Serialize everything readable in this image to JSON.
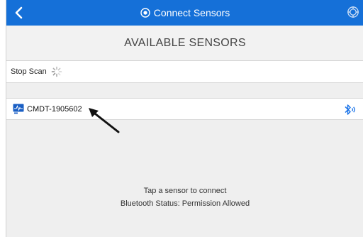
{
  "nav": {
    "title": "Connect Sensors",
    "back_icon": "chevron-left-icon",
    "settings_icon": "gear-icon",
    "bar_color": "#1570d8"
  },
  "header": {
    "title": "AVAILABLE SENSORS"
  },
  "scan": {
    "label": "Stop Scan",
    "spinner_icon": "loading-spinner-icon"
  },
  "sensors": [
    {
      "name": "CMDT-1905602",
      "icon": "sensor-device-icon",
      "status_icon": "bluetooth-icon"
    }
  ],
  "footer": {
    "hint": "Tap a sensor to connect",
    "bt_status": "Bluetooth Status: Permission Allowed"
  }
}
